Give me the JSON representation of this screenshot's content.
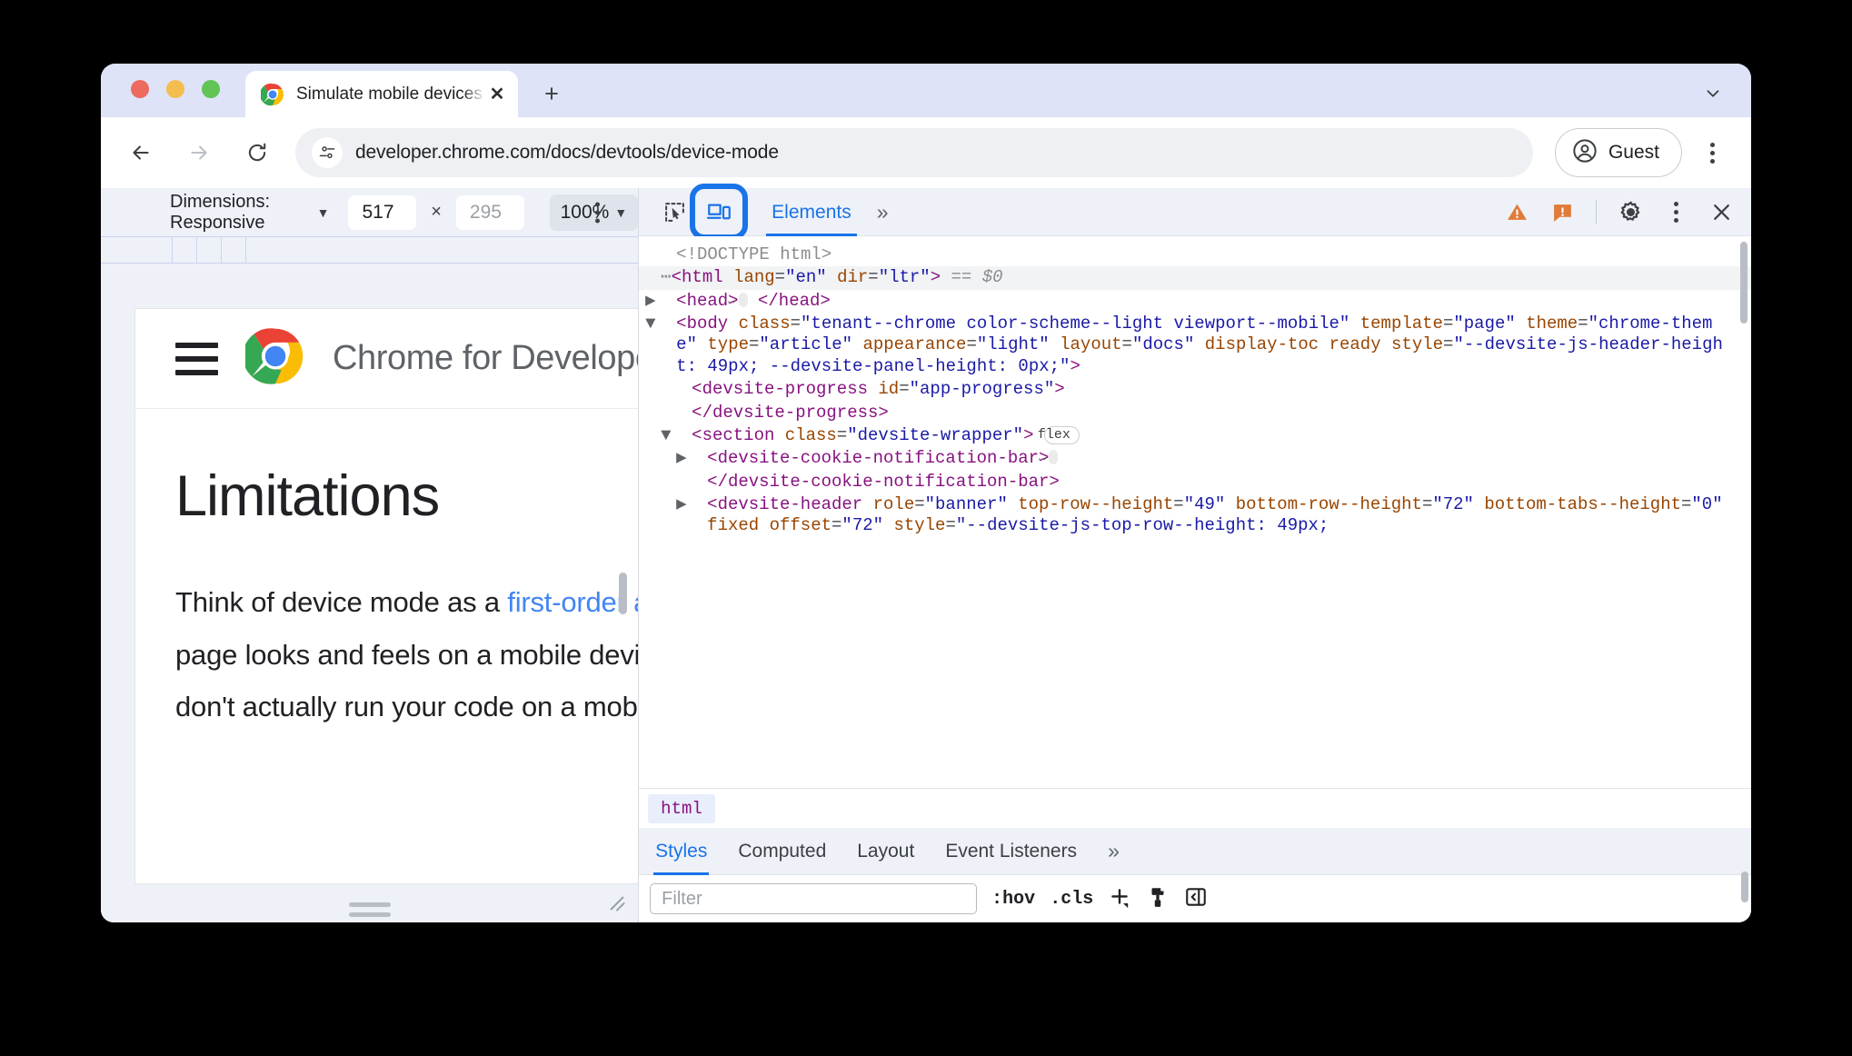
{
  "browser": {
    "tab": {
      "title": "Simulate mobile devices with",
      "close_label": "✕"
    },
    "newtab_label": "+",
    "omnibox": {
      "url": "developer.chrome.com/docs/devtools/device-mode"
    },
    "profile": {
      "label": "Guest"
    }
  },
  "device_toolbar": {
    "dimensions_label": "Dimensions: Responsive",
    "caret": "▼",
    "width_value": "517",
    "height_placeholder": "295",
    "separator": "×",
    "zoom_value": "100%"
  },
  "page": {
    "brand": "Chrome for Developers",
    "heading": "Limitations",
    "paragraph_lines": [
      {
        "pre": "Think of device mode as a ",
        "link": "first-order approximation",
        "post": ""
      },
      {
        "pre": "page looks and feels on a mobile device. With devic",
        "link": "",
        "post": ""
      },
      {
        "pre": "don't actually run your code on a mobile device. You",
        "link": "",
        "post": ""
      }
    ]
  },
  "devtools": {
    "tab_elements": "Elements",
    "more_tabs": "»",
    "dom": [
      {
        "indent": 1,
        "arrow": "",
        "parts": [
          {
            "c": "gray",
            "t": "<!DOCTYPE html>"
          }
        ]
      },
      {
        "indent": 0,
        "arrow": "",
        "selected": true,
        "parts": [
          {
            "c": "gray",
            "t": "⋯"
          },
          {
            "c": "tagn",
            "t": "<html "
          },
          {
            "c": "attn",
            "t": "lang"
          },
          {
            "c": "txt",
            "t": "="
          },
          {
            "c": "attv",
            "t": "\"en\""
          },
          {
            "c": "txt",
            "t": " "
          },
          {
            "c": "attn",
            "t": "dir"
          },
          {
            "c": "txt",
            "t": "="
          },
          {
            "c": "attv",
            "t": "\"ltr\""
          },
          {
            "c": "tagn",
            "t": ">"
          },
          {
            "c": "ital",
            "t": " == $0"
          }
        ]
      },
      {
        "indent": 1,
        "arrow": "▶",
        "parts": [
          {
            "c": "tagn",
            "t": "<head>"
          },
          {
            "c": "ellip",
            "t": "…"
          },
          {
            "c": "tagn",
            "t": " </head>"
          }
        ]
      },
      {
        "indent": 1,
        "arrow": "▼",
        "parts": [
          {
            "c": "tagn",
            "t": "<body "
          },
          {
            "c": "attn",
            "t": "class"
          },
          {
            "c": "txt",
            "t": "="
          },
          {
            "c": "attv",
            "t": "\"tenant--chrome color-scheme--light viewport--mobile\""
          },
          {
            "c": "txt",
            "t": " "
          },
          {
            "c": "attn",
            "t": "template"
          },
          {
            "c": "txt",
            "t": "="
          },
          {
            "c": "attv",
            "t": "\"page\""
          },
          {
            "c": "txt",
            "t": " "
          },
          {
            "c": "attn",
            "t": "theme"
          },
          {
            "c": "txt",
            "t": "="
          },
          {
            "c": "attv",
            "t": "\"chrome-theme\""
          },
          {
            "c": "txt",
            "t": " "
          },
          {
            "c": "attn",
            "t": "type"
          },
          {
            "c": "txt",
            "t": "="
          },
          {
            "c": "attv",
            "t": "\"article\""
          },
          {
            "c": "txt",
            "t": " "
          },
          {
            "c": "attn",
            "t": "appearance"
          },
          {
            "c": "txt",
            "t": "="
          },
          {
            "c": "attv",
            "t": "\"light\""
          },
          {
            "c": "txt",
            "t": " "
          },
          {
            "c": "attn",
            "t": "layout"
          },
          {
            "c": "txt",
            "t": "="
          },
          {
            "c": "attv",
            "t": "\"docs\""
          },
          {
            "c": "txt",
            "t": " "
          },
          {
            "c": "attn",
            "t": "display-toc ready"
          },
          {
            "c": "txt",
            "t": " "
          },
          {
            "c": "attn",
            "t": "style"
          },
          {
            "c": "txt",
            "t": "="
          },
          {
            "c": "attv",
            "t": "\"--devsite-js-header-height: 49px; --devsite-panel-height: 0px;\""
          },
          {
            "c": "tagn",
            "t": ">"
          }
        ]
      },
      {
        "indent": 2,
        "arrow": "",
        "parts": [
          {
            "c": "tagn",
            "t": "<devsite-progress "
          },
          {
            "c": "attn",
            "t": "id"
          },
          {
            "c": "txt",
            "t": "="
          },
          {
            "c": "attv",
            "t": "\"app-progress\""
          },
          {
            "c": "tagn",
            "t": ">"
          }
        ]
      },
      {
        "indent": 2,
        "arrow": "",
        "parts": [
          {
            "c": "tagn",
            "t": "</devsite-progress>"
          }
        ]
      },
      {
        "indent": 2,
        "arrow": "▼",
        "parts": [
          {
            "c": "tagn",
            "t": "<section "
          },
          {
            "c": "attn",
            "t": "class"
          },
          {
            "c": "txt",
            "t": "="
          },
          {
            "c": "attv",
            "t": "\"devsite-wrapper\""
          },
          {
            "c": "tagn",
            "t": "> "
          },
          {
            "c": "badge-flex",
            "t": "flex"
          }
        ]
      },
      {
        "indent": 3,
        "arrow": "▶",
        "parts": [
          {
            "c": "tagn",
            "t": "<devsite-cookie-notification-bar>"
          },
          {
            "c": "ellip",
            "t": "…"
          }
        ]
      },
      {
        "indent": 3,
        "arrow": "",
        "parts": [
          {
            "c": "tagn",
            "t": "</devsite-cookie-notification-bar>"
          }
        ]
      },
      {
        "indent": 3,
        "arrow": "▶",
        "parts": [
          {
            "c": "tagn",
            "t": "<devsite-header "
          },
          {
            "c": "attn",
            "t": "role"
          },
          {
            "c": "txt",
            "t": "="
          },
          {
            "c": "attv",
            "t": "\"banner\""
          },
          {
            "c": "txt",
            "t": " "
          },
          {
            "c": "attn",
            "t": "top-row--height"
          },
          {
            "c": "txt",
            "t": "="
          },
          {
            "c": "attv",
            "t": "\"49\""
          },
          {
            "c": "txt",
            "t": " "
          },
          {
            "c": "attn",
            "t": "bottom-row--height"
          },
          {
            "c": "txt",
            "t": "="
          },
          {
            "c": "attv",
            "t": "\"72\""
          },
          {
            "c": "txt",
            "t": " "
          },
          {
            "c": "attn",
            "t": "bottom-tabs--height"
          },
          {
            "c": "txt",
            "t": "="
          },
          {
            "c": "attv",
            "t": "\"0\""
          },
          {
            "c": "txt",
            "t": " "
          },
          {
            "c": "attn",
            "t": "fixed"
          },
          {
            "c": "txt",
            "t": " "
          },
          {
            "c": "attn",
            "t": "offset"
          },
          {
            "c": "txt",
            "t": "="
          },
          {
            "c": "attv",
            "t": "\"72\""
          },
          {
            "c": "txt",
            "t": " "
          },
          {
            "c": "attn",
            "t": "style"
          },
          {
            "c": "txt",
            "t": "="
          },
          {
            "c": "attv",
            "t": "\"--devsite-js-top-row--height: 49px;"
          }
        ]
      }
    ],
    "breadcrumb": "html",
    "style_tabs": [
      {
        "label": "Styles",
        "active": true
      },
      {
        "label": "Computed",
        "active": false
      },
      {
        "label": "Layout",
        "active": false
      },
      {
        "label": "Event Listeners",
        "active": false
      }
    ],
    "style_tabs_more": "»",
    "filter_placeholder": "Filter",
    "hov_label": ":hov",
    "cls_label": ".cls"
  },
  "colors": {
    "accent_blue": "#1a73e8",
    "link_blue": "#4285f4",
    "warning_orange": "#e07b39",
    "tabstrip_bg": "#dee3f7",
    "devtools_bg": "#eef1f8"
  }
}
